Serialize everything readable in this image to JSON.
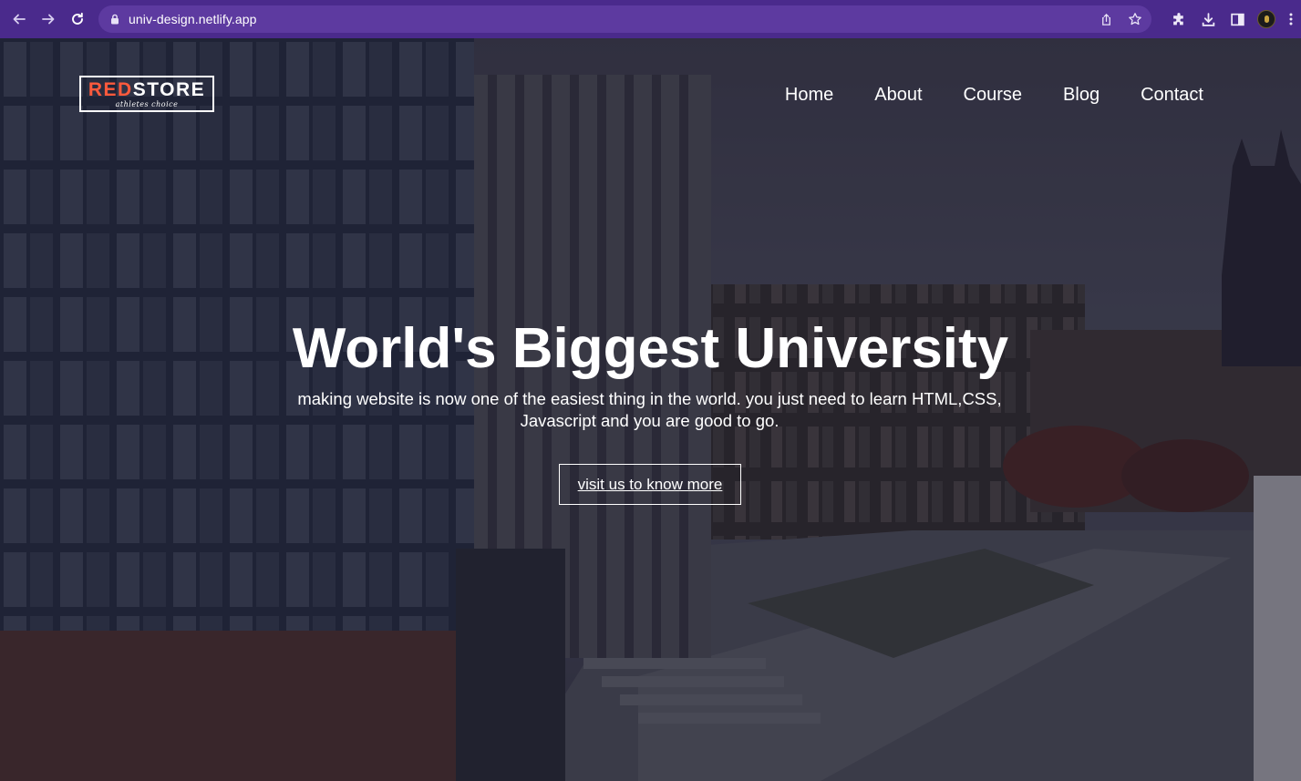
{
  "browser": {
    "url": "univ-design.netlify.app",
    "chrome_color": "#4a2a8c",
    "icons": [
      "back-icon",
      "forward-icon",
      "reload-icon",
      "lock-icon",
      "share-icon",
      "star-icon",
      "extensions-icon",
      "download-icon",
      "side-panel-icon",
      "profile-avatar"
    ]
  },
  "site": {
    "logo": {
      "red_part": "RED",
      "white_part": "STORE",
      "tagline": "athletes choice"
    },
    "nav": [
      "Home",
      "About",
      "Course",
      "Blog",
      "Contact"
    ],
    "hero": {
      "title": "World's Biggest University",
      "subtitle": "making website is now one of the easiest thing in the world. you just need to learn HTML,CSS, Javascript and you are good to go.",
      "button_label": "visit us to know more"
    },
    "colors": {
      "logo_red": "#ff5a3c",
      "text": "#ffffff"
    }
  }
}
